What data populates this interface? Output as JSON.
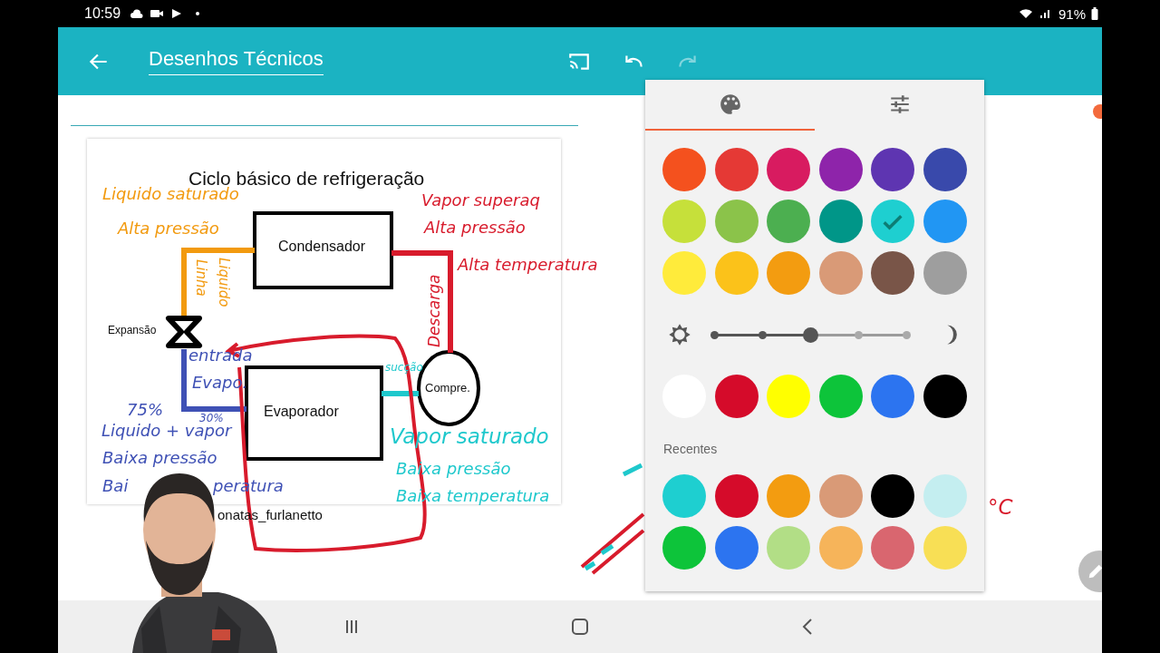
{
  "status_bar": {
    "time": "10:59",
    "battery": "91%"
  },
  "toolbar": {
    "title": "Desenhos Técnicos"
  },
  "diagram": {
    "title": "Ciclo básico de refrigeração",
    "labels": [
      {
        "kind": "condenser",
        "text": "Condensador"
      },
      {
        "kind": "expansion",
        "text": "Expansão"
      },
      {
        "kind": "evaporator",
        "text": "Evaporador"
      },
      {
        "kind": "compressor",
        "text": "Compre."
      },
      {
        "kind": "signature",
        "text": "onatas_furlanetto"
      }
    ]
  },
  "annotations": [
    {
      "kind": "line",
      "text": "Liquido saturado",
      "color": "#f29a0f"
    },
    {
      "kind": "line",
      "text": "Alta pressão",
      "color": "#f29a0f"
    },
    {
      "kind": "down",
      "text": "Linha",
      "color": "#f29a0f"
    },
    {
      "kind": "down",
      "text": "Liquido",
      "color": "#f29a0f"
    },
    {
      "kind": "line",
      "text": "Vapor superaq",
      "color": "#d81b2c"
    },
    {
      "kind": "line",
      "text": "Alta pressão",
      "color": "#d81b2c"
    },
    {
      "kind": "line",
      "text": "Alta temperatura",
      "color": "#d81b2c"
    },
    {
      "kind": "up",
      "text": "Descarga",
      "color": "#d81b2c"
    },
    {
      "kind": "line",
      "text": "entrada",
      "color": "#3f51b5"
    },
    {
      "kind": "line",
      "text": "Evapo.",
      "color": "#3f51b5"
    },
    {
      "kind": "line",
      "text": "75%",
      "color": "#3f51b5"
    },
    {
      "kind": "small",
      "text": "30%",
      "color": "#3f51b5"
    },
    {
      "kind": "line",
      "text": "Liquido + vapor",
      "color": "#3f51b5"
    },
    {
      "kind": "line",
      "text": "Baixa pressão",
      "color": "#3f51b5"
    },
    {
      "kind": "line",
      "text": "Bai",
      "color": "#3f51b5"
    },
    {
      "kind": "line",
      "text": "peratura",
      "color": "#3f51b5"
    },
    {
      "kind": "small",
      "text": "sucção",
      "color": "#1ec8cc"
    },
    {
      "kind": "big",
      "text": "Vapor saturado",
      "color": "#1ec8cc"
    },
    {
      "kind": "line",
      "text": "Baixa pressão",
      "color": "#1ec8cc"
    },
    {
      "kind": "line",
      "text": "Baixa temperatura",
      "color": "#1ec8cc"
    },
    {
      "kind": "big",
      "text": "°C",
      "color": "#d81b2c"
    }
  ],
  "color_picker": {
    "tabs": [
      {
        "selected": true
      },
      {
        "selected": false
      }
    ],
    "palette": [
      {
        "color": "#f4511e",
        "selected": false
      },
      {
        "color": "#e53935",
        "selected": false
      },
      {
        "color": "#d81b60",
        "selected": false
      },
      {
        "color": "#8e24aa",
        "selected": false
      },
      {
        "color": "#5e35b1",
        "selected": false
      },
      {
        "color": "#3949ab",
        "selected": false
      },
      {
        "color": "#c6e03a",
        "selected": false
      },
      {
        "color": "#8bc34a",
        "selected": false
      },
      {
        "color": "#4caf50",
        "selected": false
      },
      {
        "color": "#009688",
        "selected": false
      },
      {
        "color": "#1ecfd0",
        "selected": true
      },
      {
        "color": "#2196f3",
        "selected": false
      },
      {
        "color": "#ffeb3b",
        "selected": false
      },
      {
        "color": "#fbc21a",
        "selected": false
      },
      {
        "color": "#f39c10",
        "selected": false
      },
      {
        "color": "#d99a77",
        "selected": false
      },
      {
        "color": "#795548",
        "selected": false
      },
      {
        "color": "#9e9e9e",
        "selected": false
      }
    ],
    "brightness": {
      "level": 0.5
    },
    "basic_colors": [
      {
        "color": "#ffffff"
      },
      {
        "color": "#d50b2a"
      },
      {
        "color": "#ffff00"
      },
      {
        "color": "#0dc43a"
      },
      {
        "color": "#2c74f0"
      },
      {
        "color": "#000000"
      }
    ],
    "recent_label": "Recentes",
    "recent_colors": [
      {
        "color": "#1ecfd0"
      },
      {
        "color": "#d50b2a"
      },
      {
        "color": "#f39c10"
      },
      {
        "color": "#d99a77"
      },
      {
        "color": "#000000"
      },
      {
        "color": "#c4eef0"
      },
      {
        "color": "#0dc43a"
      },
      {
        "color": "#2c74f0"
      },
      {
        "color": "#b2de86"
      },
      {
        "color": "#f6b45a"
      },
      {
        "color": "#d9666f"
      },
      {
        "color": "#f8df55"
      }
    ]
  }
}
